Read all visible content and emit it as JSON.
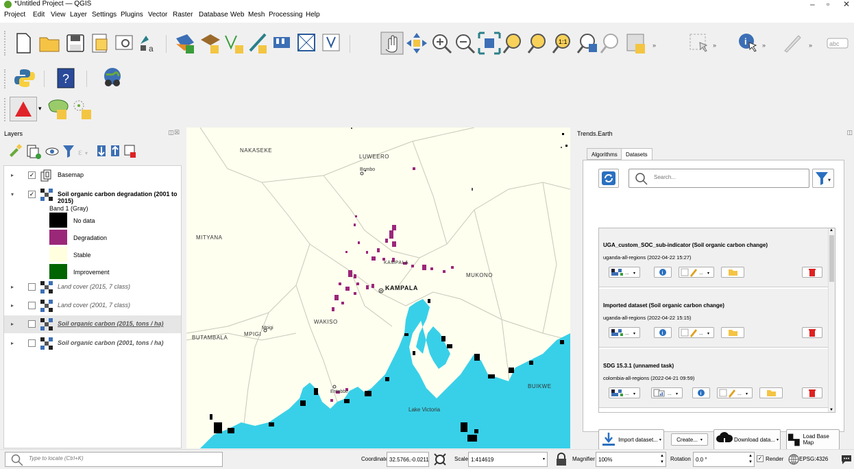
{
  "window": {
    "title": "*Untitled Project — QGIS"
  },
  "menu": [
    "Project",
    "Edit",
    "View",
    "Layer",
    "Settings",
    "Plugins",
    "Vector",
    "Raster",
    "Database",
    "Web",
    "Mesh",
    "Processing",
    "Help"
  ],
  "layers_panel": {
    "title": "Layers",
    "layers": [
      {
        "name": "Basemap",
        "checked": true,
        "expanded": false,
        "style": "normal"
      },
      {
        "name": "Soil organic carbon degradation (2001 to 2015)",
        "checked": true,
        "expanded": true,
        "style": "bold"
      },
      {
        "name": "Land cover (2015, 7 class)",
        "checked": false,
        "expanded": false,
        "style": "italic"
      },
      {
        "name": "Land cover (2001, 7 class)",
        "checked": false,
        "expanded": false,
        "style": "italic"
      },
      {
        "name": "Soil organic carbon (2015, tons / ha)",
        "checked": false,
        "expanded": false,
        "style": "italic-underline"
      },
      {
        "name": "Soil organic carbon (2001, tons / ha)",
        "checked": false,
        "expanded": false,
        "style": "italic"
      }
    ],
    "band_label": "Band 1 (Gray)",
    "legend": [
      {
        "label": "No data",
        "color": "#000000"
      },
      {
        "label": "Degradation",
        "color": "#9b2779"
      },
      {
        "label": "Stable",
        "color": "#ffffe0"
      },
      {
        "label": "Improvement",
        "color": "#006400"
      }
    ]
  },
  "map": {
    "places": [
      "NAKASEKE",
      "LUWEERO",
      "Bombo",
      "MITYANA",
      "KAMPALA",
      "MUKONO",
      "KAMPALA",
      "WAKISO",
      "MPIGI",
      "Mpigi",
      "BUTAMBALA",
      "Entebbe",
      "BUIKWE",
      "Lake Victoria"
    ],
    "water_color": "#38d0e8",
    "land_color": "#fffff0"
  },
  "trends_earth": {
    "title": "Trends.Earth",
    "tabs": [
      "Algorithms",
      "Datasets"
    ],
    "search_placeholder": "Search...",
    "datasets": [
      {
        "title": "UGA_custom_SOC_sub-indicator (Soil organic carbon change)",
        "subtitle": "uganda-all-regions (2022-04-22 15:27)"
      },
      {
        "title": "Imported dataset (Soil organic carbon change)",
        "subtitle": "uganda-all-regions (2022-04-22 15:15)"
      },
      {
        "title": "SDG 15.3.1 (unnamed task)",
        "subtitle": "colombia-all-regions (2022-04-21 09:59)"
      }
    ],
    "buttons": {
      "import": "Import dataset...",
      "create": "Create...",
      "download": "Download data...",
      "basemap": "Load Base Map"
    }
  },
  "statusbar": {
    "locate_placeholder": "Type to locate (Ctrl+K)",
    "coordinate_label": "Coordinate",
    "coordinate_value": "32.5766,-0.0211",
    "scale_label": "Scale",
    "scale_value": "1:414619",
    "magnifier_label": "Magnifier",
    "magnifier_value": "100%",
    "rotation_label": "Rotation",
    "rotation_value": "0.0 °",
    "render_label": "Render",
    "crs": "EPSG:4326"
  }
}
